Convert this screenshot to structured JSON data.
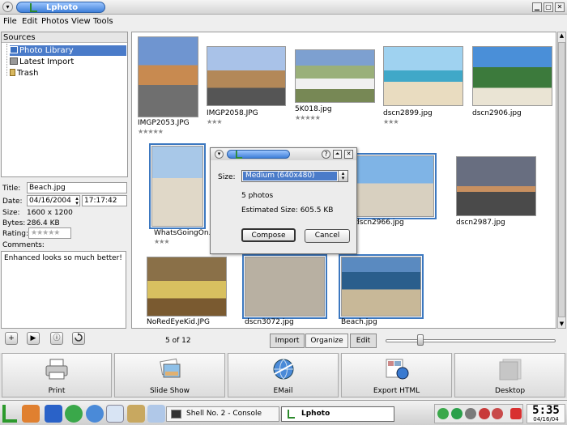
{
  "window": {
    "title": "Lphoto",
    "menu_glyph": "▾",
    "btn_min": "▁",
    "btn_max": "▢",
    "btn_close": "✕"
  },
  "menu": [
    "File",
    "Edit",
    "Photos",
    "View",
    "Tools"
  ],
  "sources": {
    "header": "Sources",
    "items": [
      {
        "label": "Photo Library",
        "icon": "library-icon",
        "selected": true
      },
      {
        "label": "Latest Import",
        "icon": "import-icon",
        "selected": false
      },
      {
        "label": "Trash",
        "icon": "trash-icon",
        "selected": false
      }
    ]
  },
  "properties": {
    "title_label": "Title:",
    "title_value": "Beach.jpg",
    "date_label": "Date:",
    "date_value": "04/16/2004",
    "time_value": "17:17:42",
    "size_label": "Size:",
    "size_value": "1600 x 1200",
    "bytes_label": "Bytes:",
    "bytes_value": "286.4 KB",
    "rating_label": "Rating:",
    "rating_value": "★★★★★",
    "comments_label": "Comments:",
    "comments_value": "Enhanced looks so much better!"
  },
  "photos": [
    {
      "name": "IMGP2053.JPG",
      "stars": "★★★★★",
      "color": "#8aa0b8",
      "selected": false
    },
    {
      "name": "IMGP2058.JPG",
      "stars": "★★★",
      "color": "#7f98b0",
      "selected": false
    },
    {
      "name": "5K018.jpg",
      "stars": "★★★★★",
      "color": "#9fb07a",
      "selected": false
    },
    {
      "name": "dscn2899.jpg",
      "stars": "★★★",
      "color": "#6cb5d8",
      "selected": false
    },
    {
      "name": "dscn2906.jpg",
      "stars": "",
      "color": "#5a9bd4",
      "selected": false
    },
    {
      "name": "WhatsGoingOn.jpg",
      "stars": "★★★",
      "color": "#a9c2d8",
      "selected": true
    },
    {
      "name": "dscn2966.jpg",
      "stars": "",
      "color": "#7fb1e0",
      "selected": true
    },
    {
      "name": "dscn2987.jpg",
      "stars": "",
      "color": "#8a8e9a",
      "selected": false
    },
    {
      "name": "NoRedEyeKid.JPG",
      "stars": "",
      "color": "#a08a5a",
      "selected": false
    },
    {
      "name": "dscn3072.jpg",
      "stars": "",
      "color": "#b8b0a2",
      "selected": true
    },
    {
      "name": "Beach.jpg",
      "stars": "",
      "color": "#2e6c9c",
      "selected": true
    }
  ],
  "dialog": {
    "size_label": "Size:",
    "size_value": "Medium (640x480)",
    "photo_count": "5 photos",
    "estimated": "Estimated Size: 605.5 KB",
    "compose": "Compose",
    "cancel": "Cancel",
    "btn_help": "?",
    "btn_shade": "⏶",
    "btn_close": "✕"
  },
  "controls": {
    "page_info": "5 of 12",
    "play_glyph": "▶",
    "info_glyph": "ⓘ",
    "add_glyph": "+",
    "tabs": [
      "Import",
      "Organize",
      "Edit"
    ],
    "active_tab": "Organize"
  },
  "actions": [
    "Print",
    "Slide Show",
    "EMail",
    "Export HTML",
    "Desktop"
  ],
  "taskbar": {
    "tasks": [
      "Shell No. 2 - Console",
      "Lphoto"
    ],
    "clock_time": "5:35",
    "clock_date": "04/16/04"
  }
}
